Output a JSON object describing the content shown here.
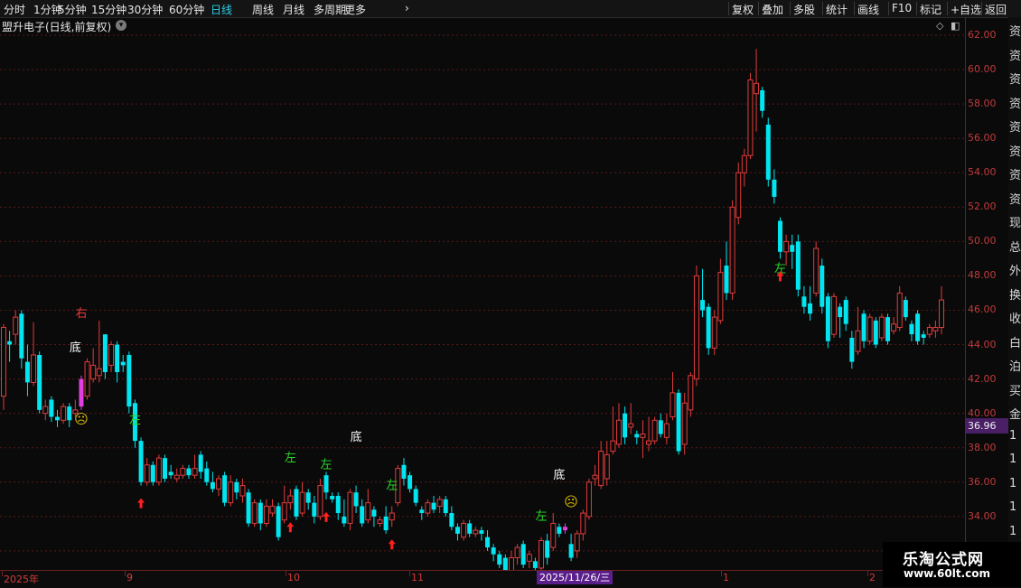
{
  "toolbar": {
    "period_tabs": [
      "分时",
      "1分钟",
      "5分钟",
      "15分钟",
      "30分钟",
      "60分钟",
      "日线",
      "周线",
      "月线",
      "多周期",
      "更多"
    ],
    "active_tab": "日线",
    "right_buttons": [
      "复权",
      "叠加",
      "多股",
      "统计",
      "画线",
      "F10",
      "标记",
      "+自选",
      "返回"
    ]
  },
  "stock": {
    "title": "盟升电子(日线,前复权)",
    "current_price": "36.96"
  },
  "price_axis": {
    "ticks": [
      "62.00",
      "60.00",
      "58.00",
      "56.00",
      "54.00",
      "52.00",
      "50.00",
      "48.00",
      "46.00",
      "44.00",
      "42.00",
      "40.00",
      "38.00",
      "36.00",
      "34.00",
      "32.00"
    ]
  },
  "x_axis": {
    "labels": [
      "2025年",
      "9",
      "10",
      "11",
      "1",
      "2"
    ],
    "cursor_date": "2025/11/26/三"
  },
  "side_panel": {
    "chars": [
      "资",
      "资",
      "资",
      "资",
      "资",
      "资",
      "资",
      "资",
      "现",
      "总",
      "外",
      "换",
      "收",
      "白",
      "泊",
      "买",
      "金",
      "1",
      "1",
      "1",
      "1",
      "1",
      "1"
    ]
  },
  "watermark": {
    "title": "乐淘公式网",
    "url": "www.60lt.com"
  },
  "chart_data": {
    "type": "candlestick",
    "ylim": [
      31.0,
      63.0
    ],
    "up_color": "#e23b3b",
    "down_color": "#00e5f0",
    "signal_up_color": "#e040e0",
    "candles": [
      {
        "o": 41.0,
        "c": 45.0,
        "h": 45.2,
        "l": 40.2
      },
      {
        "o": 44.2,
        "c": 44.0,
        "h": 44.8,
        "l": 43.0
      },
      {
        "o": 44.6,
        "c": 45.6,
        "h": 46.0,
        "l": 44.0
      },
      {
        "o": 45.8,
        "c": 43.2,
        "h": 46.0,
        "l": 42.6
      },
      {
        "o": 43.0,
        "c": 41.8,
        "h": 44.0,
        "l": 41.0
      },
      {
        "o": 41.8,
        "c": 43.4,
        "h": 45.3,
        "l": 41.6
      },
      {
        "o": 43.4,
        "c": 40.2,
        "h": 43.6,
        "l": 40.0
      },
      {
        "o": 40.0,
        "c": 40.4,
        "h": 40.8,
        "l": 39.6
      },
      {
        "o": 40.8,
        "c": 39.8,
        "h": 41.0,
        "l": 39.5
      },
      {
        "o": 39.8,
        "c": 39.6,
        "h": 40.2,
        "l": 39.2
      },
      {
        "o": 39.6,
        "c": 40.4,
        "h": 40.6,
        "l": 39.4
      },
      {
        "o": 40.4,
        "c": 39.6,
        "h": 40.6,
        "l": 39.2
      },
      {
        "o": 40.0,
        "c": 40.2,
        "h": 40.8,
        "l": 39.8
      },
      {
        "o": 40.4,
        "c": 42.0,
        "h": 42.2,
        "l": 40.2
      },
      {
        "o": 41.0,
        "c": 43.0,
        "h": 43.2,
        "l": 40.8
      },
      {
        "o": 42.0,
        "c": 42.8,
        "h": 43.8,
        "l": 41.8
      },
      {
        "o": 42.2,
        "c": 42.6,
        "h": 45.4,
        "l": 41.8
      },
      {
        "o": 44.6,
        "c": 42.4,
        "h": 44.6,
        "l": 42.0
      },
      {
        "o": 42.8,
        "c": 44.0,
        "h": 44.2,
        "l": 42.4
      },
      {
        "o": 44.0,
        "c": 42.4,
        "h": 44.2,
        "l": 41.8
      },
      {
        "o": 43.0,
        "c": 42.8,
        "h": 43.4,
        "l": 42.4
      },
      {
        "o": 43.4,
        "c": 40.4,
        "h": 43.6,
        "l": 40.0
      },
      {
        "o": 40.6,
        "c": 38.4,
        "h": 40.8,
        "l": 38.0
      },
      {
        "o": 38.4,
        "c": 36.0,
        "h": 38.6,
        "l": 35.8
      },
      {
        "o": 36.0,
        "c": 37.0,
        "h": 37.4,
        "l": 35.8
      },
      {
        "o": 37.0,
        "c": 36.0,
        "h": 37.2,
        "l": 35.8
      },
      {
        "o": 36.0,
        "c": 37.4,
        "h": 37.6,
        "l": 35.8
      },
      {
        "o": 37.4,
        "c": 36.2,
        "h": 37.6,
        "l": 36.0
      },
      {
        "o": 36.6,
        "c": 36.4,
        "h": 37.0,
        "l": 36.2
      },
      {
        "o": 36.2,
        "c": 36.4,
        "h": 36.8,
        "l": 36.0
      },
      {
        "o": 36.4,
        "c": 36.8,
        "h": 37.0,
        "l": 36.2
      },
      {
        "o": 36.8,
        "c": 36.4,
        "h": 37.0,
        "l": 36.2
      },
      {
        "o": 36.4,
        "c": 36.8,
        "h": 37.6,
        "l": 36.2
      },
      {
        "o": 37.6,
        "c": 36.6,
        "h": 37.8,
        "l": 36.2
      },
      {
        "o": 36.8,
        "c": 36.0,
        "h": 37.2,
        "l": 35.8
      },
      {
        "o": 36.0,
        "c": 35.6,
        "h": 36.6,
        "l": 35.4
      },
      {
        "o": 35.6,
        "c": 36.2,
        "h": 36.4,
        "l": 35.2
      },
      {
        "o": 36.4,
        "c": 34.8,
        "h": 36.6,
        "l": 34.6
      },
      {
        "o": 34.8,
        "c": 36.0,
        "h": 36.4,
        "l": 34.6
      },
      {
        "o": 36.0,
        "c": 35.4,
        "h": 36.2,
        "l": 35.0
      },
      {
        "o": 35.2,
        "c": 35.8,
        "h": 36.2,
        "l": 34.8
      },
      {
        "o": 35.4,
        "c": 33.6,
        "h": 35.6,
        "l": 33.4
      },
      {
        "o": 33.6,
        "c": 34.8,
        "h": 35.0,
        "l": 33.4
      },
      {
        "o": 34.8,
        "c": 33.6,
        "h": 35.0,
        "l": 33.2
      },
      {
        "o": 33.6,
        "c": 34.6,
        "h": 35.0,
        "l": 33.4
      },
      {
        "o": 34.2,
        "c": 34.6,
        "h": 35.0,
        "l": 34.0
      },
      {
        "o": 34.6,
        "c": 32.8,
        "h": 34.8,
        "l": 32.6
      },
      {
        "o": 33.8,
        "c": 34.8,
        "h": 35.8,
        "l": 33.6
      },
      {
        "o": 34.8,
        "c": 35.2,
        "h": 35.6,
        "l": 34.4
      },
      {
        "o": 35.6,
        "c": 34.0,
        "h": 35.8,
        "l": 33.8
      },
      {
        "o": 34.2,
        "c": 35.4,
        "h": 36.0,
        "l": 34.0
      },
      {
        "o": 35.4,
        "c": 34.8,
        "h": 35.6,
        "l": 34.4
      },
      {
        "o": 34.8,
        "c": 34.0,
        "h": 35.2,
        "l": 33.6
      },
      {
        "o": 34.0,
        "c": 35.8,
        "h": 36.2,
        "l": 33.8
      },
      {
        "o": 36.4,
        "c": 35.4,
        "h": 36.6,
        "l": 35.0
      },
      {
        "o": 35.2,
        "c": 35.0,
        "h": 35.4,
        "l": 34.8
      },
      {
        "o": 35.2,
        "c": 34.2,
        "h": 35.4,
        "l": 33.8
      },
      {
        "o": 34.0,
        "c": 33.6,
        "h": 35.0,
        "l": 33.4
      },
      {
        "o": 33.6,
        "c": 35.4,
        "h": 35.6,
        "l": 33.2
      },
      {
        "o": 35.4,
        "c": 34.6,
        "h": 35.8,
        "l": 34.2
      },
      {
        "o": 34.6,
        "c": 33.6,
        "h": 35.0,
        "l": 33.4
      },
      {
        "o": 33.8,
        "c": 34.8,
        "h": 35.6,
        "l": 33.6
      },
      {
        "o": 34.4,
        "c": 34.0,
        "h": 34.6,
        "l": 33.4
      },
      {
        "o": 33.6,
        "c": 33.8,
        "h": 34.0,
        "l": 33.4
      },
      {
        "o": 34.0,
        "c": 33.2,
        "h": 34.6,
        "l": 33.0
      },
      {
        "o": 33.8,
        "c": 34.2,
        "h": 34.6,
        "l": 33.4
      },
      {
        "o": 34.8,
        "c": 36.8,
        "h": 37.0,
        "l": 34.6
      },
      {
        "o": 37.0,
        "c": 36.2,
        "h": 37.4,
        "l": 35.8
      },
      {
        "o": 36.4,
        "c": 35.6,
        "h": 36.6,
        "l": 35.4
      },
      {
        "o": 35.6,
        "c": 34.8,
        "h": 35.8,
        "l": 34.6
      },
      {
        "o": 34.4,
        "c": 34.2,
        "h": 34.6,
        "l": 33.8
      },
      {
        "o": 34.2,
        "c": 34.8,
        "h": 35.0,
        "l": 34.0
      },
      {
        "o": 34.8,
        "c": 34.4,
        "h": 35.2,
        "l": 34.2
      },
      {
        "o": 34.6,
        "c": 35.0,
        "h": 35.2,
        "l": 34.2
      },
      {
        "o": 35.0,
        "c": 34.2,
        "h": 35.2,
        "l": 34.0
      },
      {
        "o": 34.2,
        "c": 33.4,
        "h": 34.6,
        "l": 33.2
      },
      {
        "o": 33.4,
        "c": 33.0,
        "h": 33.6,
        "l": 32.6
      },
      {
        "o": 32.8,
        "c": 33.6,
        "h": 33.8,
        "l": 32.6
      },
      {
        "o": 33.6,
        "c": 33.0,
        "h": 33.8,
        "l": 32.8
      },
      {
        "o": 33.0,
        "c": 33.2,
        "h": 33.4,
        "l": 32.8
      },
      {
        "o": 33.2,
        "c": 33.0,
        "h": 33.4,
        "l": 32.6
      },
      {
        "o": 32.8,
        "c": 32.2,
        "h": 33.2,
        "l": 32.0
      },
      {
        "o": 32.2,
        "c": 31.8,
        "h": 32.4,
        "l": 31.4
      },
      {
        "o": 31.8,
        "c": 31.2,
        "h": 32.0,
        "l": 31.0
      },
      {
        "o": 31.6,
        "c": 30.6,
        "h": 31.8,
        "l": 30.4
      },
      {
        "o": 30.6,
        "c": 31.6,
        "h": 32.0,
        "l": 30.4
      },
      {
        "o": 31.6,
        "c": 32.2,
        "h": 32.4,
        "l": 31.2
      },
      {
        "o": 32.4,
        "c": 31.2,
        "h": 32.6,
        "l": 31.0
      },
      {
        "o": 31.4,
        "c": 31.8,
        "h": 32.0,
        "l": 31.0
      },
      {
        "o": 31.4,
        "c": 31.0,
        "h": 31.6,
        "l": 30.8
      },
      {
        "o": 31.0,
        "c": 32.6,
        "h": 32.8,
        "l": 30.8
      },
      {
        "o": 32.6,
        "c": 31.6,
        "h": 33.0,
        "l": 31.2
      },
      {
        "o": 32.2,
        "c": 33.6,
        "h": 34.2,
        "l": 32.0
      },
      {
        "o": 33.4,
        "c": 33.0,
        "h": 33.6,
        "l": 32.8
      },
      {
        "o": 33.2,
        "c": 33.4,
        "h": 33.6,
        "l": 33.0
      },
      {
        "o": 32.4,
        "c": 31.6,
        "h": 33.0,
        "l": 31.4
      },
      {
        "o": 32.0,
        "c": 33.0,
        "h": 33.2,
        "l": 31.6
      },
      {
        "o": 33.0,
        "c": 34.2,
        "h": 34.4,
        "l": 32.6
      },
      {
        "o": 34.0,
        "c": 36.0,
        "h": 36.2,
        "l": 33.8
      },
      {
        "o": 36.2,
        "c": 36.4,
        "h": 37.0,
        "l": 35.8
      },
      {
        "o": 35.8,
        "c": 37.8,
        "h": 38.4,
        "l": 35.6
      },
      {
        "o": 36.2,
        "c": 37.6,
        "h": 38.4,
        "l": 35.8
      },
      {
        "o": 37.8,
        "c": 38.4,
        "h": 40.4,
        "l": 37.6
      },
      {
        "o": 38.2,
        "c": 39.6,
        "h": 40.6,
        "l": 38.0
      },
      {
        "o": 40.0,
        "c": 38.6,
        "h": 40.4,
        "l": 38.2
      },
      {
        "o": 39.2,
        "c": 39.4,
        "h": 40.6,
        "l": 38.8
      },
      {
        "o": 38.8,
        "c": 38.6,
        "h": 39.0,
        "l": 38.2
      },
      {
        "o": 38.6,
        "c": 38.8,
        "h": 39.6,
        "l": 37.4
      },
      {
        "o": 38.2,
        "c": 38.4,
        "h": 39.8,
        "l": 37.8
      },
      {
        "o": 38.4,
        "c": 39.6,
        "h": 39.8,
        "l": 38.2
      },
      {
        "o": 39.6,
        "c": 38.8,
        "h": 40.0,
        "l": 38.6
      },
      {
        "o": 38.6,
        "c": 39.4,
        "h": 40.0,
        "l": 38.2
      },
      {
        "o": 39.8,
        "c": 41.2,
        "h": 42.4,
        "l": 39.6
      },
      {
        "o": 41.2,
        "c": 37.8,
        "h": 41.4,
        "l": 37.6
      },
      {
        "o": 38.2,
        "c": 40.6,
        "h": 41.2,
        "l": 37.6
      },
      {
        "o": 40.2,
        "c": 42.2,
        "h": 42.4,
        "l": 39.8
      },
      {
        "o": 42.0,
        "c": 48.0,
        "h": 48.6,
        "l": 41.6
      },
      {
        "o": 46.6,
        "c": 46.0,
        "h": 48.4,
        "l": 45.6
      },
      {
        "o": 46.2,
        "c": 43.8,
        "h": 46.4,
        "l": 43.4
      },
      {
        "o": 43.8,
        "c": 45.6,
        "h": 46.0,
        "l": 43.4
      },
      {
        "o": 45.4,
        "c": 48.2,
        "h": 49.0,
        "l": 45.2
      },
      {
        "o": 48.6,
        "c": 47.0,
        "h": 50.0,
        "l": 46.6
      },
      {
        "o": 47.0,
        "c": 52.0,
        "h": 52.4,
        "l": 46.6
      },
      {
        "o": 51.4,
        "c": 54.0,
        "h": 54.6,
        "l": 51.0
      },
      {
        "o": 54.0,
        "c": 55.0,
        "h": 55.4,
        "l": 53.2
      },
      {
        "o": 55.0,
        "c": 59.4,
        "h": 59.8,
        "l": 54.8
      },
      {
        "o": 58.6,
        "c": 59.2,
        "h": 61.2,
        "l": 56.4
      },
      {
        "o": 58.8,
        "c": 57.6,
        "h": 59.0,
        "l": 57.2
      },
      {
        "o": 56.8,
        "c": 53.6,
        "h": 57.2,
        "l": 53.2
      },
      {
        "o": 53.6,
        "c": 52.6,
        "h": 54.2,
        "l": 52.2
      },
      {
        "o": 51.2,
        "c": 49.4,
        "h": 51.4,
        "l": 49.0
      },
      {
        "o": 49.4,
        "c": 50.0,
        "h": 50.4,
        "l": 48.6
      },
      {
        "o": 49.8,
        "c": 49.4,
        "h": 50.4,
        "l": 48.4
      },
      {
        "o": 50.0,
        "c": 47.2,
        "h": 50.4,
        "l": 46.8
      },
      {
        "o": 46.8,
        "c": 46.2,
        "h": 47.4,
        "l": 45.8
      },
      {
        "o": 46.4,
        "c": 45.8,
        "h": 47.4,
        "l": 45.4
      },
      {
        "o": 47.0,
        "c": 49.6,
        "h": 50.0,
        "l": 46.8
      },
      {
        "o": 48.6,
        "c": 46.2,
        "h": 49.0,
        "l": 45.8
      },
      {
        "o": 46.8,
        "c": 44.2,
        "h": 47.0,
        "l": 43.8
      },
      {
        "o": 44.6,
        "c": 46.8,
        "h": 47.0,
        "l": 44.4
      },
      {
        "o": 46.2,
        "c": 45.6,
        "h": 46.4,
        "l": 44.4
      },
      {
        "o": 46.6,
        "c": 45.2,
        "h": 46.8,
        "l": 44.8
      },
      {
        "o": 44.4,
        "c": 43.0,
        "h": 44.8,
        "l": 42.6
      },
      {
        "o": 43.6,
        "c": 44.8,
        "h": 46.2,
        "l": 43.4
      },
      {
        "o": 45.8,
        "c": 44.2,
        "h": 46.0,
        "l": 43.8
      },
      {
        "o": 44.2,
        "c": 45.6,
        "h": 45.8,
        "l": 44.0
      },
      {
        "o": 45.4,
        "c": 44.0,
        "h": 45.6,
        "l": 43.8
      },
      {
        "o": 44.4,
        "c": 45.6,
        "h": 45.8,
        "l": 44.2
      },
      {
        "o": 45.6,
        "c": 44.2,
        "h": 45.8,
        "l": 44.0
      },
      {
        "o": 44.8,
        "c": 45.2,
        "h": 45.6,
        "l": 44.6
      },
      {
        "o": 45.0,
        "c": 47.0,
        "h": 47.4,
        "l": 44.8
      },
      {
        "o": 46.6,
        "c": 45.6,
        "h": 46.8,
        "l": 45.4
      },
      {
        "o": 45.2,
        "c": 44.6,
        "h": 45.4,
        "l": 44.2
      },
      {
        "o": 45.8,
        "c": 44.2,
        "h": 46.0,
        "l": 44.0
      },
      {
        "o": 44.6,
        "c": 44.4,
        "h": 44.8,
        "l": 44.0
      },
      {
        "o": 44.6,
        "c": 45.0,
        "h": 45.2,
        "l": 44.4
      },
      {
        "o": 44.8,
        "c": 45.0,
        "h": 45.4,
        "l": 44.4
      },
      {
        "o": 45.0,
        "c": 46.6,
        "h": 47.4,
        "l": 44.6
      }
    ],
    "signal_bars": [
      13,
      94
    ],
    "annotations": [
      {
        "i": 13,
        "text": "右",
        "color": "#e23b3b",
        "price": 45.6
      },
      {
        "i": 12,
        "text": "底",
        "color": "#ffffff",
        "price": 43.6
      },
      {
        "i": 13,
        "text": "☹",
        "color": "#e0c000",
        "price": 39.4
      },
      {
        "i": 22,
        "text": "左",
        "color": "#29d829",
        "price": 39.4
      },
      {
        "i": 48,
        "text": "左",
        "color": "#29d829",
        "price": 37.2
      },
      {
        "i": 54,
        "text": "左",
        "color": "#29d829",
        "price": 36.8
      },
      {
        "i": 59,
        "text": "底",
        "color": "#ffffff",
        "price": 38.4
      },
      {
        "i": 65,
        "text": "左",
        "color": "#29d829",
        "price": 35.6
      },
      {
        "i": 90,
        "text": "左",
        "color": "#29d829",
        "price": 33.8
      },
      {
        "i": 93,
        "text": "底",
        "color": "#ffffff",
        "price": 36.2
      },
      {
        "i": 95,
        "text": "☹",
        "color": "#e0c000",
        "price": 34.6
      },
      {
        "i": 130,
        "text": "左",
        "color": "#29d829",
        "price": 48.2
      }
    ],
    "arrows": [
      23,
      48,
      54,
      65,
      90,
      130
    ],
    "arrow_color": "#ff2020"
  }
}
